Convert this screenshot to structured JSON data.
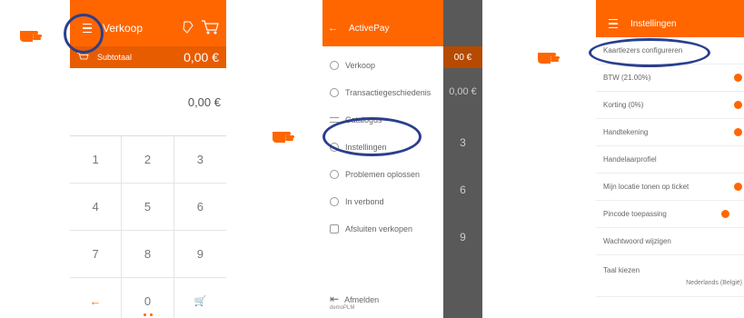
{
  "phone1": {
    "title": "Verkoop",
    "subtotal_label": "Subtotaal",
    "subtotal_amount": "0,00 €",
    "total_display": "0,00 €",
    "keys": [
      "1",
      "2",
      "3",
      "4",
      "5",
      "6",
      "7",
      "8",
      "9",
      "←",
      "0",
      "🛒"
    ]
  },
  "phone2": {
    "title": "ActivePay",
    "menu": [
      {
        "label": "Verkoop"
      },
      {
        "label": "Transactiegeschiedenis"
      },
      {
        "label": "Catalogus"
      },
      {
        "label": "Instellingen"
      },
      {
        "label": "Problemen oplossen"
      },
      {
        "label": "In verbond"
      },
      {
        "label": "Afsluiten verkopen"
      }
    ],
    "strip_amount": "00 €",
    "strip_total": "0,00 €",
    "strip_numbers": [
      "3",
      "6",
      "9"
    ],
    "logout_label": "Afmelden",
    "logout_user": "demoPLM"
  },
  "phone3": {
    "title": "Instellingen",
    "rows": [
      {
        "label": "Kaartlezers configureren",
        "toggle": false
      },
      {
        "label": "BTW (21.00%)",
        "toggle": true
      },
      {
        "label": "Korting (0%)",
        "toggle": true
      },
      {
        "label": "Handtekening",
        "toggle": true
      },
      {
        "label": "Handelaarprofiel",
        "toggle": false
      },
      {
        "label": "Mijn locatie tonen op ticket",
        "toggle": true
      },
      {
        "label": "Pincode toepassing",
        "toggle": true
      },
      {
        "label": "Wachtwoord wijzigen",
        "toggle": false
      }
    ],
    "language_label": "Taal kiezen",
    "language_value": "Nederlands (België)"
  },
  "colors": {
    "accent": "#ff6600",
    "highlight_ring": "#2a3f8f"
  }
}
